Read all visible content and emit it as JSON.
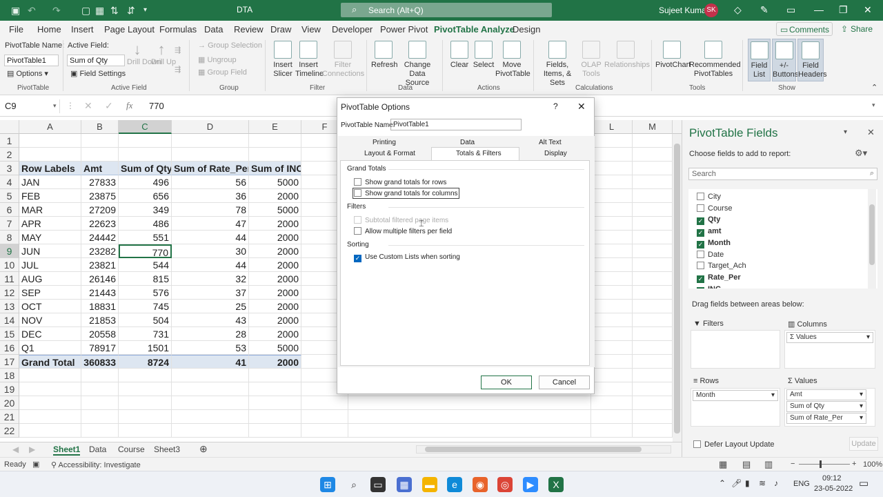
{
  "titlebar": {
    "doc_name": "DTA",
    "search_placeholder": "Search (Alt+Q)",
    "user_name": "Sujeet Kumar",
    "user_initials": "SK"
  },
  "menu": {
    "tabs": [
      "File",
      "Home",
      "Insert",
      "Page Layout",
      "Formulas",
      "Data",
      "Review",
      "Draw",
      "View",
      "Developer",
      "Power Pivot",
      "PivotTable Analyze",
      "Design"
    ],
    "comments": "Comments",
    "share": "Share"
  },
  "ribbon": {
    "pivottable_name_label": "PivotTable Name:",
    "pivottable_name_value": "PivotTable1",
    "options_label": "Options",
    "pivottable_group": "PivotTable",
    "active_field_label": "Active Field:",
    "active_field_value": "Sum of Qty",
    "field_settings": "Field Settings",
    "drill_down": "Drill Down",
    "drill_up": "Drill Up",
    "active_field_group": "Active Field",
    "group_selection": "Group Selection",
    "ungroup": "Ungroup",
    "group_field": "Group Field",
    "group_group": "Group",
    "insert_slicer": "Insert Slicer",
    "insert_timeline": "Insert Timeline",
    "filter_connections": "Filter Connections",
    "filter_group": "Filter",
    "refresh": "Refresh",
    "change_data_source": "Change Data Source",
    "data_group": "Data",
    "clear": "Clear",
    "select": "Select",
    "move_pivottable": "Move PivotTable",
    "actions_group": "Actions",
    "fields_items_sets": "Fields, Items, & Sets",
    "olap_tools": "OLAP Tools",
    "relationships": "Relationships",
    "calculations_group": "Calculations",
    "pivotchart": "PivotChart",
    "recommended_pivottables": "Recommended PivotTables",
    "tools_group": "Tools",
    "field_list": "Field List",
    "plus_minus_buttons": "+/- Buttons",
    "field_headers": "Field Headers",
    "show_group": "Show"
  },
  "formula_bar": {
    "name_box": "C9",
    "fx": "fx",
    "value": "770"
  },
  "grid": {
    "columns": [
      "A",
      "B",
      "C",
      "D",
      "E",
      "F",
      "L",
      "M"
    ],
    "row_numbers": [
      "1",
      "2",
      "3",
      "4",
      "5",
      "6",
      "7",
      "8",
      "9",
      "10",
      "11",
      "12",
      "13",
      "14",
      "15",
      "16",
      "17",
      "18",
      "19",
      "20",
      "21",
      "22"
    ],
    "header": [
      "Row Labels",
      "Amt",
      "Sum of Qty",
      "Sum of Rate_Per",
      "Sum of INC"
    ],
    "rows": [
      [
        "JAN",
        "27833",
        "496",
        "56",
        "5000"
      ],
      [
        "FEB",
        "23875",
        "656",
        "36",
        "2000"
      ],
      [
        "MAR",
        "27209",
        "349",
        "78",
        "5000"
      ],
      [
        "APR",
        "22623",
        "486",
        "47",
        "2000"
      ],
      [
        "MAY",
        "24442",
        "551",
        "44",
        "2000"
      ],
      [
        "JUN",
        "23282",
        "770",
        "30",
        "2000"
      ],
      [
        "JUL",
        "23821",
        "544",
        "44",
        "2000"
      ],
      [
        "AUG",
        "26146",
        "815",
        "32",
        "2000"
      ],
      [
        "SEP",
        "21443",
        "576",
        "37",
        "2000"
      ],
      [
        "OCT",
        "18831",
        "745",
        "25",
        "2000"
      ],
      [
        "NOV",
        "21853",
        "504",
        "43",
        "2000"
      ],
      [
        "DEC",
        "20558",
        "731",
        "28",
        "2000"
      ],
      [
        "Q1",
        "78917",
        "1501",
        "53",
        "5000"
      ]
    ],
    "total": [
      "Grand Total",
      "360833",
      "8724",
      "41",
      "2000"
    ]
  },
  "sheets": [
    "Sheet1",
    "Data",
    "Course",
    "Sheet3"
  ],
  "status": {
    "ready": "Ready",
    "accessibility": "Accessibility: Investigate",
    "zoom": "100%"
  },
  "pane": {
    "title": "PivotTable Fields",
    "subtitle": "Choose fields to add to report:",
    "search_placeholder": "Search",
    "fields": [
      {
        "name": "City",
        "checked": false
      },
      {
        "name": "Course",
        "checked": false
      },
      {
        "name": "Qty",
        "checked": true
      },
      {
        "name": "amt",
        "checked": true
      },
      {
        "name": "Month",
        "checked": true
      },
      {
        "name": "Date",
        "checked": false
      },
      {
        "name": "Target_Ach",
        "checked": false
      },
      {
        "name": "Rate_Per",
        "checked": true
      },
      {
        "name": "INC",
        "checked": true
      }
    ],
    "drag_label": "Drag fields between areas below:",
    "filters": "Filters",
    "columns": "Columns",
    "rows": "Rows",
    "values": "Values",
    "columns_item": "Values",
    "columns_sigma": "Σ",
    "rows_item": "Month",
    "values_items": [
      "Amt",
      "Sum of Qty",
      "Sum of Rate_Per"
    ],
    "defer": "Defer Layout Update",
    "update": "Update"
  },
  "dialog": {
    "title": "PivotTable Options",
    "name_label": "PivotTable Name:",
    "name_value": "PivotTable1",
    "tabs_top": [
      "Printing",
      "Data",
      "Alt Text"
    ],
    "tabs_bottom": [
      "Layout & Format",
      "Totals & Filters",
      "Display"
    ],
    "grand_totals": "Grand Totals",
    "show_rows": "Show grand totals for rows",
    "show_columns": "Show grand totals for columns",
    "filters": "Filters",
    "subtotal_filtered": "Subtotal filtered page items",
    "allow_multiple": "Allow multiple filters per field",
    "sorting": "Sorting",
    "use_custom": "Use Custom Lists when sorting",
    "ok": "OK",
    "cancel": "Cancel"
  },
  "taskbar": {
    "lang": "ENG",
    "time": "09:12",
    "date": "23-05-2022"
  },
  "colors": {
    "excel_green": "#217346",
    "pivot_header": "#dde6f1"
  }
}
